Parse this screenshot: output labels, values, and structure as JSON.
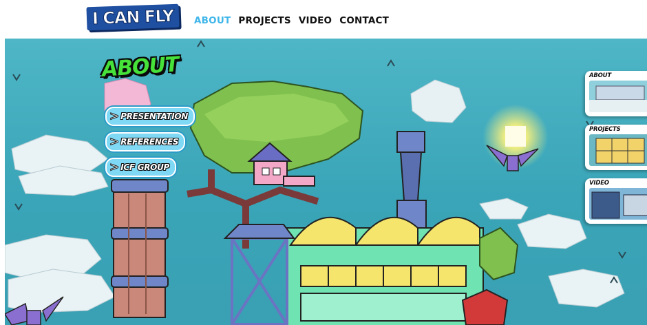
{
  "logo": {
    "text": "I CAN FLY"
  },
  "nav": {
    "items": [
      {
        "label": "ABOUT",
        "active": true
      },
      {
        "label": "PROJECTS",
        "active": false
      },
      {
        "label": "VIDEO",
        "active": false
      },
      {
        "label": "CONTACT",
        "active": false
      }
    ]
  },
  "about": {
    "title": "ABOUT",
    "links": [
      {
        "label": "PRESENTATION"
      },
      {
        "label": "REFERENCES"
      },
      {
        "label": "ICF GROUP"
      }
    ]
  },
  "side_panel": {
    "cards": [
      {
        "title": "ABOUT"
      },
      {
        "title": "PROJECTS"
      },
      {
        "title": "VIDEO"
      }
    ]
  },
  "colors": {
    "nav_active": "#3fb6ea",
    "sky": "#4eb6c6",
    "title_green": "#46e23a",
    "button_fill": "#7fd8f4"
  }
}
